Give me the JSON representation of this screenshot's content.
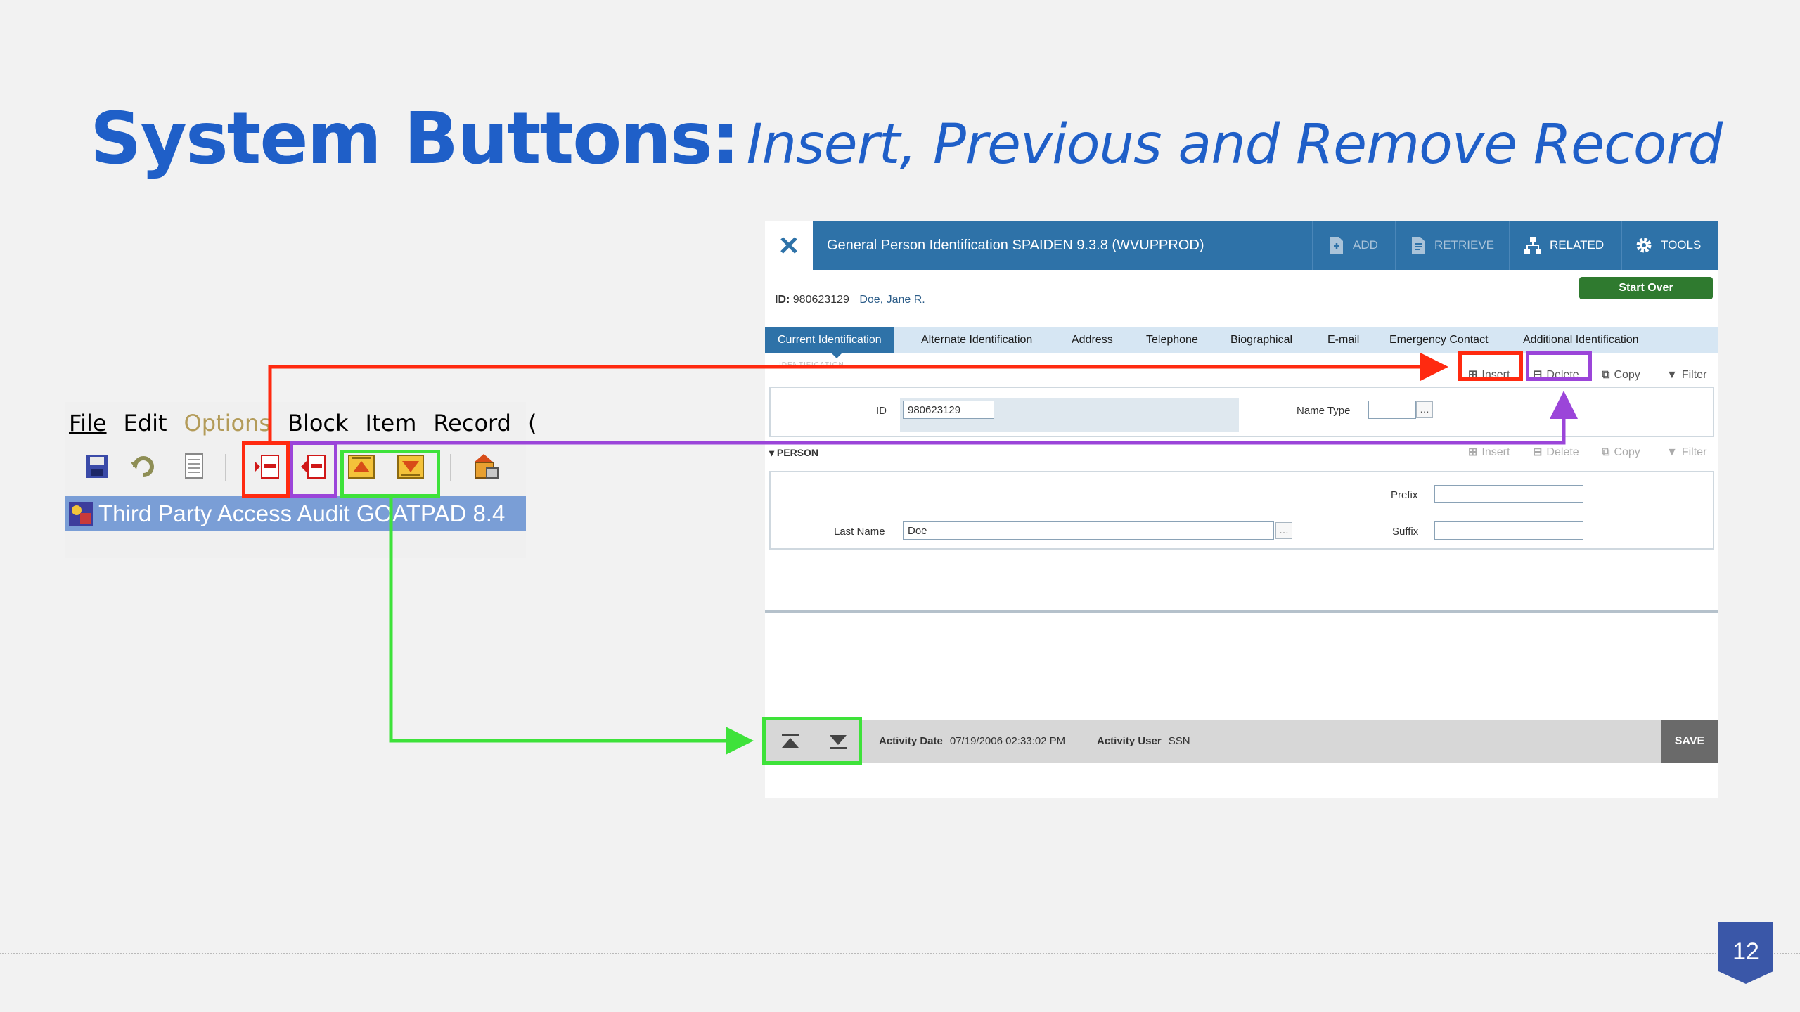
{
  "slide": {
    "title_main": "System Buttons:",
    "title_sub": "Insert, Previous and Remove Record",
    "page_number": "12"
  },
  "legacy": {
    "menu": [
      "File",
      "Edit",
      "Options",
      "Block",
      "Item",
      "Record",
      "("
    ],
    "window_title": "Third Party Access Audit  GOATPAD  8.4",
    "toolbar_icons": [
      "save-icon",
      "undo-icon",
      "document-icon",
      "insert-record-icon",
      "remove-record-icon",
      "previous-block-icon",
      "next-block-icon",
      "exit-icon"
    ]
  },
  "banner": {
    "title": "General Person Identification SPAIDEN 9.3.8 (WVUPPROD)",
    "actions": {
      "add": "ADD",
      "retrieve": "RETRIEVE",
      "related": "RELATED",
      "tools": "TOOLS"
    },
    "start_over": "Start Over",
    "id_label": "ID:",
    "id_value": "980623129",
    "person_name": "Doe, Jane R.",
    "tabs": [
      "Current Identification",
      "Alternate Identification",
      "Address",
      "Telephone",
      "Biographical",
      "E-mail",
      "Emergency Contact",
      "Additional Identification"
    ],
    "section_label": "IDENTIFICATION",
    "section_buttons": {
      "insert": "Insert",
      "delete": "Delete",
      "copy": "Copy",
      "filter": "Filter"
    },
    "fields": {
      "id_label": "ID",
      "id_value": "980623129",
      "name_type_label": "Name Type",
      "name_type_value": "",
      "prefix_label": "Prefix",
      "prefix_value": "",
      "last_name_label": "Last Name",
      "last_name_value": "Doe",
      "suffix_label": "Suffix",
      "suffix_value": ""
    },
    "person_section": "PERSON",
    "footer": {
      "activity_date_label": "Activity Date",
      "activity_date_value": "07/19/2006 02:33:02 PM",
      "activity_user_label": "Activity User",
      "activity_user_value": "SSN",
      "save": "SAVE"
    }
  },
  "colors": {
    "title_blue": "#1f5fc8",
    "banner_blue": "#2e72a8",
    "highlight_insert": "#ff2a10",
    "highlight_delete": "#9b45d9",
    "highlight_navigate": "#3ee23a",
    "start_over_green": "#2f7a2f"
  }
}
